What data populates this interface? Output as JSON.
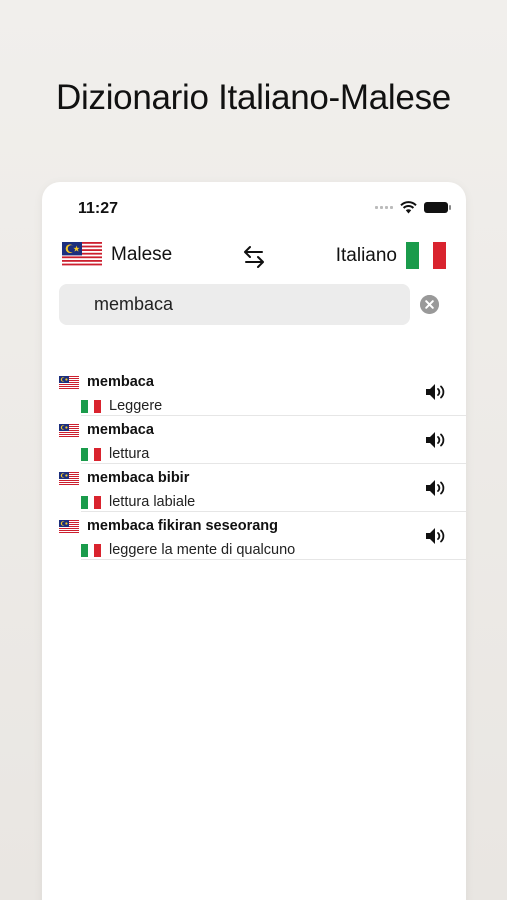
{
  "title": "Dizionario Italiano-Malese",
  "status": {
    "time": "11:27"
  },
  "languages": {
    "source": {
      "label": "Malese",
      "flag": "malaysia-flag-icon"
    },
    "target": {
      "label": "Italiano",
      "flag": "italy-flag-icon"
    }
  },
  "search": {
    "value": "membaca"
  },
  "results": [
    {
      "term": "membaca",
      "translation": "Leggere"
    },
    {
      "term": "membaca",
      "translation": "lettura"
    },
    {
      "term": "membaca bibir",
      "translation": "lettura labiale"
    },
    {
      "term": "membaca fikiran seseorang",
      "translation": "leggere la mente di qualcuno"
    }
  ],
  "colors": {
    "italy_green": "#1a9b4b",
    "italy_red": "#d9232e",
    "malaysia_blue": "#1c2f7d",
    "malaysia_red": "#cc1f2e",
    "malaysia_yellow": "#f7c927"
  }
}
